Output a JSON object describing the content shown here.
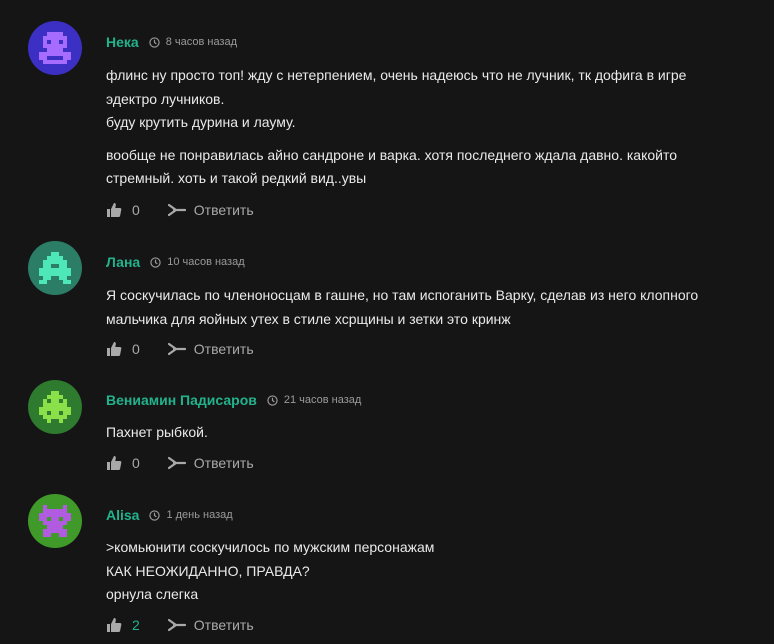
{
  "comments": [
    {
      "author": "Нека",
      "time": "8 часов назад",
      "avatar_color": "#3b2fc4",
      "avatar_fg": "#a66bff",
      "lines": [
        "флинс ну просто топ! жду с нетерпением, очень надеюсь что не лучник, тк дофига в игре",
        "эдектро лучников.",
        "буду крутить дурина и лауму.",
        "вообще не понравилась айно сандроне и варка. хотя последнего ждала давно. какойто",
        "стремный. хоть и такой редкий вид..увы"
      ],
      "likes": "0",
      "reply_label": "Ответить"
    },
    {
      "author": "Лана",
      "time": "10 часов назад",
      "avatar_color": "#2b7d66",
      "avatar_fg": "#4ee8b8",
      "lines": [
        "Я соскучилась по членоносцам в гашне, но там испоганить Варку, сделав из него клопного",
        "мальчика для яойных утех в стиле хсрщины и зетки это кринж"
      ],
      "likes": "0",
      "reply_label": "Ответить"
    },
    {
      "author": "Вениамин Падисаров",
      "time": "21 часов назад",
      "avatar_color": "#2e7a2e",
      "avatar_fg": "#8be04a",
      "lines": [
        "Пахнет рыбкой."
      ],
      "likes": "0",
      "reply_label": "Ответить"
    },
    {
      "author": "Alisa",
      "time": "1 день назад",
      "avatar_color": "#3f9a2a",
      "avatar_fg": "#b05be0",
      "lines": [
        ">комьюнити соскучилось по мужским персонажам",
        "КАК НЕОЖИДАННО, ПРАВДА?",
        "орнула слегка"
      ],
      "likes": "2",
      "reply_label": "Ответить"
    }
  ]
}
